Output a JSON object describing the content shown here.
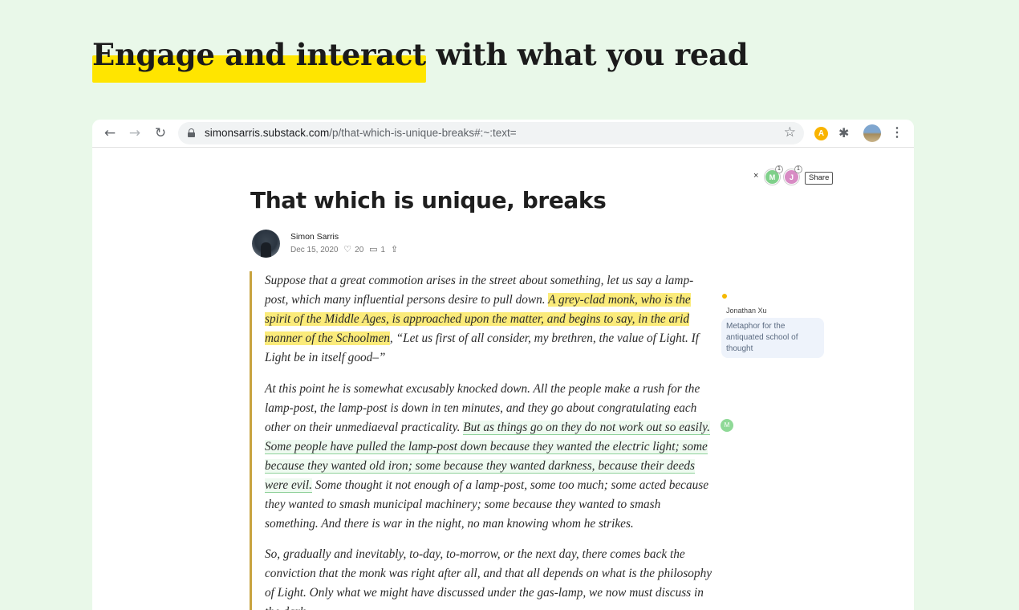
{
  "hero": {
    "highlighted": "Engage and interact",
    "rest": " with what you read"
  },
  "browser": {
    "url_domain": "simonsarris.substack.com",
    "url_path": "/p/that-which-is-unique-breaks#:~:text=",
    "extension_letter": "A",
    "colors": {
      "extension": "#f9b400"
    }
  },
  "collab": {
    "close": "×",
    "avatars": [
      {
        "letter": "M",
        "badge": "1",
        "color": "#7fd08a"
      },
      {
        "letter": "J",
        "badge": "1",
        "color": "#d88bc4"
      }
    ],
    "share_label": "Share"
  },
  "post": {
    "title": "That which is unique, breaks",
    "author": "Simon Sarris",
    "date": "Dec 15, 2020",
    "likes": "20",
    "comments": "1"
  },
  "article": {
    "p1_a": "Suppose that a great commotion arises in the street about something, let us say a lamp-post, which many influential persons desire to pull down. ",
    "p1_hl": "A grey-clad monk, who is the spirit of the Middle Ages, is approached upon the matter, and begins to say, in the arid manner of the Schoolmen",
    "p1_b": ", “Let us first of all consider, my brethren, the value of Light. If Light be in itself good–”",
    "p2_a": "At this point he is somewhat excusably knocked down. All the people make a rush for the lamp-post, the lamp-post is down in ten minutes, and they go about congratulating each other on their unmediaeval practicality. ",
    "p2_hl": "But as things go on they do not work out so easily. Some people have pulled the lamp-post down because they wanted the electric light; some because they wanted old iron; some because they wanted darkness, because their deeds were evil.",
    "p2_b": " Some thought it not enough of a lamp-post, some too much; some acted because they wanted to smash municipal machinery; some because they wanted to smash something. And there is war in the night, no man knowing whom he strikes.",
    "p3": "So, gradually and inevitably, to-day, to-morrow, or the next day, there comes back the conviction that the monk was right after all, and that all depends on what is the philosophy of Light. Only what we might have discussed under the gas-lamp, we now must discuss in the dark."
  },
  "comment": {
    "author": "Jonathan Xu",
    "text": "Metaphor for the antiquated school of thought",
    "marker_letter": "M"
  }
}
